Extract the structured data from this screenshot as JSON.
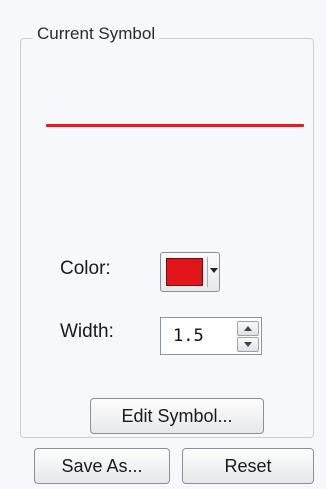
{
  "group": {
    "title": "Current Symbol"
  },
  "symbol": {
    "line_color": "#d8232a"
  },
  "color": {
    "label": "Color:",
    "value": "#e4141b"
  },
  "width": {
    "label": "Width:",
    "value": "1.5"
  },
  "buttons": {
    "edit_symbol": "Edit Symbol...",
    "save_as": "Save As...",
    "reset": "Reset"
  }
}
